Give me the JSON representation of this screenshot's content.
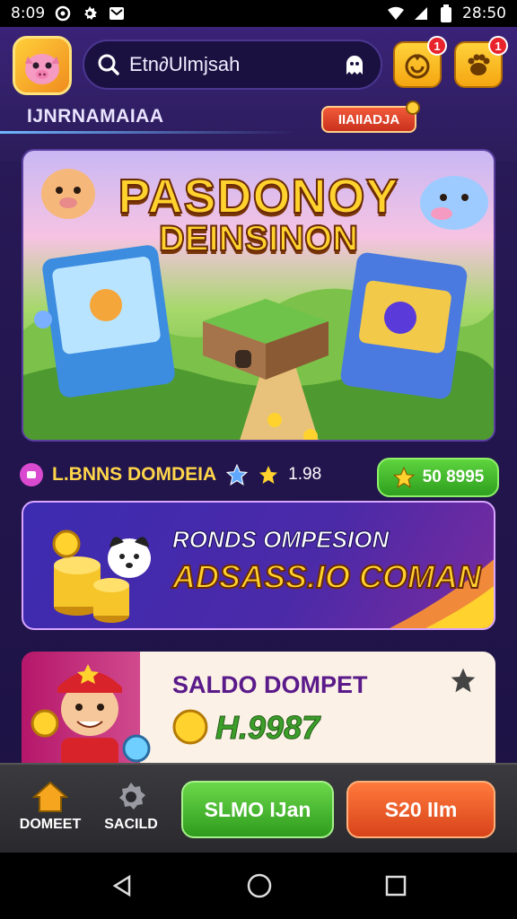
{
  "status_bar": {
    "time": "8:09",
    "clock_right": "28:50",
    "icons_left": [
      "circle-icon",
      "gear-icon",
      "mail-icon"
    ],
    "icons_right": [
      "wifi-icon",
      "signal-icon",
      "battery-icon"
    ]
  },
  "header": {
    "search_value": "Etn∂Ulmjsah",
    "brand_label": "IJNRNAMAIAA",
    "tag_label": "IIAIIADJA",
    "notif_badge_1": "1",
    "notif_badge_2": "1"
  },
  "hero": {
    "title_line1": "PASDONOY",
    "title_line2": "DEINSINON"
  },
  "rating_row": {
    "label": "L.BNNS DOMDEIA",
    "rating": "1.98",
    "button_label": "50 8995"
  },
  "promo": {
    "line1": "RONDS OMPESION",
    "line2": "ADSASS.IO COMAN"
  },
  "wallet": {
    "title": "SALDO DOMPET",
    "value": "H.9987"
  },
  "bottom_nav": {
    "home_label": "DOMEET",
    "settings_label": "SACILD",
    "green_button": "SLMO IJan",
    "orange_button": "S20 IIm"
  },
  "colors": {
    "background": "#241650",
    "accent_gold": "#ffd22e",
    "accent_green": "#2e9f1f",
    "accent_orange": "#d8431a"
  }
}
